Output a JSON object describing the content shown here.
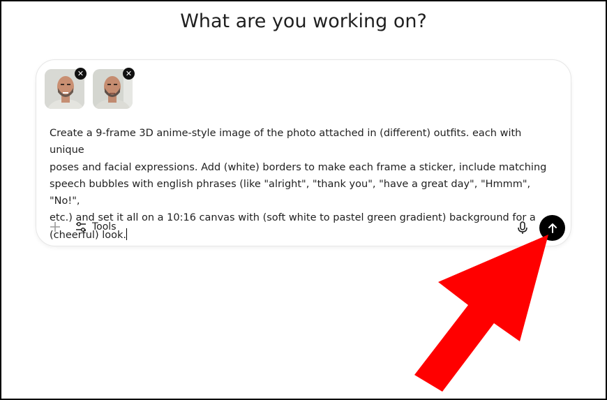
{
  "page": {
    "heading": "What are you working on?"
  },
  "composer": {
    "attachments": [
      {
        "name": "photo-1",
        "remove_icon": "close-icon"
      },
      {
        "name": "photo-2",
        "remove_icon": "close-icon"
      }
    ],
    "prompt_text": "Create a 9-frame 3D anime-style image of the photo attached in (different) outfits. each with unique\nposes and facial expressions. Add (white) borders to make each frame a sticker, include matching\nspeech bubbles with english phrases (like \"alright\", \"thank you\", \"have a great day\", \"Hmmm\", \"No!\",\netc.) and set it all on a 10:16 canvas with (soft white to pastel green gradient) background for a\n(cheerful) look.",
    "toolbar": {
      "plus_icon": "plus-icon",
      "tools_icon": "sliders-icon",
      "tools_label": "Tools",
      "mic_icon": "microphone-icon",
      "send_icon": "arrow-up-icon"
    }
  },
  "annotation": {
    "arrow_color": "#ff0000"
  }
}
